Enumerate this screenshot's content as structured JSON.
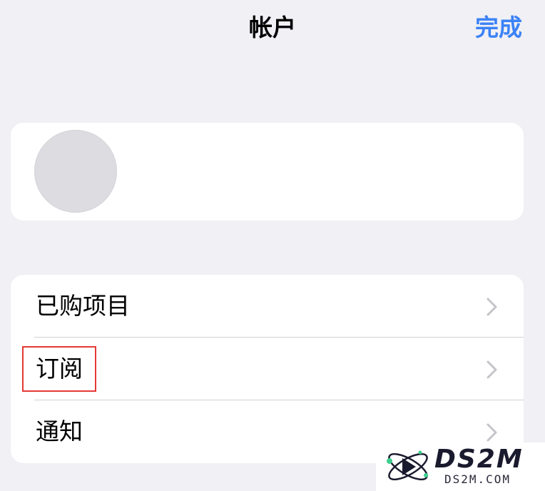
{
  "nav": {
    "title": "帐户",
    "done_label": "完成"
  },
  "list": {
    "items": [
      {
        "label": "已购项目"
      },
      {
        "label": "订阅"
      },
      {
        "label": "通知"
      }
    ]
  },
  "watermark": {
    "name": "DS2M",
    "domain": "DS2M.COM"
  },
  "colors": {
    "accent": "#3b82f6",
    "background": "#f0f0f5",
    "highlight": "#e53935"
  }
}
